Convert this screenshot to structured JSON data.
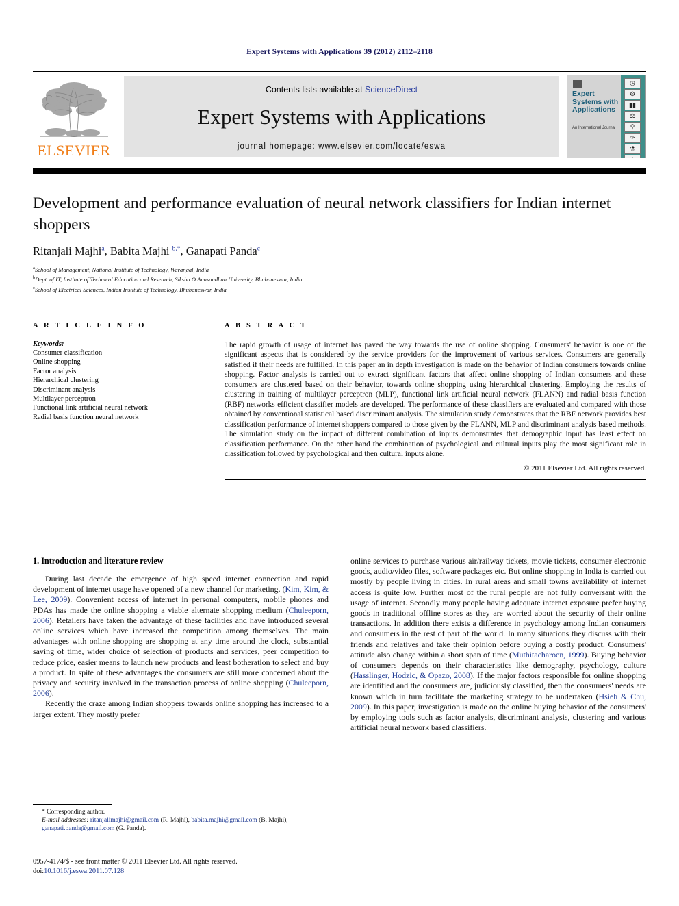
{
  "running_head": "Expert Systems with Applications 39 (2012) 2112–2118",
  "masthead": {
    "contents_prefix": "Contents lists available at ",
    "sciencedirect": "ScienceDirect",
    "journal_title": "Expert Systems with Applications",
    "homepage": "journal homepage: www.elsevier.com/locate/eswa",
    "publisher_name": "ELSEVIER",
    "cover": {
      "title": "Expert Systems with Applications",
      "subtitle": "An International Journal",
      "icons": [
        "clock-icon",
        "gear-icon",
        "bar-chart-icon",
        "scales-icon",
        "microscope-icon",
        "handshake-icon",
        "flask-icon",
        "rocket-icon"
      ]
    },
    "accent_color": "#f07f1a",
    "link_color": "#2b3fa0"
  },
  "title_block": {
    "title": "Development and performance evaluation of neural network classifiers for Indian internet shoppers",
    "authors": [
      {
        "name": "Ritanjali Majhi",
        "marks": "a"
      },
      {
        "name": "Babita Majhi",
        "marks": "b,*"
      },
      {
        "name": "Ganapati Panda",
        "marks": "c"
      }
    ],
    "affiliations": [
      {
        "mark": "a",
        "text": "School of Management, National Institute of Technology, Warangal, India"
      },
      {
        "mark": "b",
        "text": "Dept. of IT, Institute of Technical Education and Research, Siksha O Anusandhan University, Bhubaneswar, India"
      },
      {
        "mark": "c",
        "text": "School of Electrical Sciences, Indian Institute of Technology, Bhubaneswar, India"
      }
    ]
  },
  "article_info": {
    "heading": "A R T I C L E   I N F O",
    "keywords_label": "Keywords:",
    "keywords": [
      "Consumer classification",
      "Online shopping",
      "Factor analysis",
      "Hierarchical clustering",
      "Discriminant analysis",
      "Multilayer perceptron",
      "Functional link artificial neural network",
      "Radial basis function neural network"
    ]
  },
  "abstract": {
    "heading": "A B S T R A C T",
    "text": "The rapid growth of usage of internet has paved the way towards the use of online shopping. Consumers' behavior is one of the significant aspects that is considered by the service providers for the improvement of various services. Consumers are generally satisfied if their needs are fulfilled. In this paper an in depth investigation is made on the behavior of Indian consumers towards online shopping. Factor analysis is carried out to extract significant factors that affect online shopping of Indian consumers and these consumers are clustered based on their behavior, towards online shopping using hierarchical clustering. Employing the results of clustering in training of multilayer perceptron (MLP), functional link artificial neural network (FLANN) and radial basis function (RBF) networks efficient classifier models are developed. The performance of these classifiers are evaluated and compared with those obtained by conventional statistical based discriminant analysis. The simulation study demonstrates that the RBF network provides best classification performance of internet shoppers compared to those given by the FLANN, MLP and discriminant analysis based methods. The simulation study on the impact of different combination of inputs demonstrates that demographic input has least effect on classification performance. On the other hand the combination of psychological and cultural inputs play the most significant role in classification followed by psychological and then cultural inputs alone.",
    "copyright": "© 2011 Elsevier Ltd. All rights reserved."
  },
  "body": {
    "section_title": "1. Introduction and literature review",
    "left_paragraphs": [
      "During last decade the emergence of high speed internet connection and rapid development of internet usage have opened of a new channel for marketing. (Kim, Kim, & Lee, 2009). Convenient access of internet in personal computers, mobile phones and PDAs has made the online shopping a viable alternate shopping medium (Chuleeporn, 2006). Retailers have taken the advantage of these facilities and have introduced several online services which have increased the competition among themselves. The main advantages with online shopping are shopping at any time around the clock, substantial saving of time, wider choice of selection of products and services, peer competition to reduce price, easier means to launch new products and least botheration to select and buy a product. In spite of these advantages the consumers are still more concerned about the privacy and security involved in the transaction process of online shopping (Chuleeporn, 2006).",
      "Recently the craze among Indian shoppers towards online shopping has increased to a larger extent. They mostly prefer"
    ],
    "right_paragraphs": [
      "online services to purchase various air/railway tickets, movie tickets, consumer electronic goods, audio/video files, software packages etc. But online shopping in India is carried out mostly by people living in cities. In rural areas and small towns availability of internet access is quite low. Further most of the rural people are not fully conversant with the usage of internet. Secondly many people having adequate internet exposure prefer buying goods in traditional offline stores as they are worried about the security of their online transactions. In addition there exists a difference in psychology among Indian consumers and consumers in the rest of part of the world. In many situations they discuss with their friends and relatives and take their opinion before buying a costly product. Consumers' attitude also change within a short span of time (Muthitacharoen, 1999). Buying behavior of consumers depends on their characteristics like demography, psychology, culture (Hasslinger, Hodzic, & Opazo, 2008). If the major factors responsible for online shopping are identified and the consumers are, judiciously classified, then the consumers' needs are known which in turn facilitate the marketing strategy to be undertaken (Hsieh & Chu, 2009). In this paper, investigation is made on the online buying behavior of the consumers' by employing tools such as factor analysis, discriminant analysis, clustering and various artificial neural network based classifiers."
    ],
    "citation_color": "#1f3a93"
  },
  "footnotes": {
    "corresponding": "* Corresponding author.",
    "email_label": "E-mail addresses:",
    "emails": [
      {
        "address": "ritanjalimajhi@gmail.com",
        "who": "(R. Majhi)"
      },
      {
        "address": "babita.majhi@gmail.com",
        "who": "(B. Majhi)"
      },
      {
        "address": "ganapati.panda@gmail.com",
        "who": "(G. Panda)"
      }
    ]
  },
  "imprint": {
    "issn_line": "0957-4174/$ - see front matter © 2011 Elsevier Ltd. All rights reserved.",
    "doi_label": "doi:",
    "doi": "10.1016/j.eswa.2011.07.128"
  }
}
